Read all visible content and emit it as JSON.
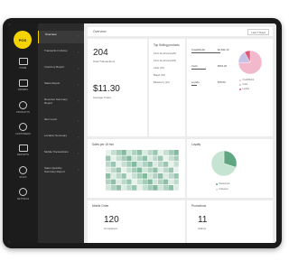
{
  "brand": {
    "logo_text": "POS"
  },
  "rail": [
    {
      "label": "HOME",
      "icon": "grid-icon"
    },
    {
      "label": "ORDERS",
      "icon": "receipt-icon"
    },
    {
      "label": "PRODUCTS",
      "icon": "box-icon"
    },
    {
      "label": "CUSTOMERS",
      "icon": "people-icon"
    },
    {
      "label": "REPORTS",
      "icon": "map-icon"
    },
    {
      "label": "STAFF",
      "icon": "person-icon"
    },
    {
      "label": "SETTINGS",
      "icon": "gear-icon"
    }
  ],
  "menu": [
    {
      "label": "Overview",
      "active": true
    },
    {
      "label": "Transaction History"
    },
    {
      "label": "Inventory Report"
    },
    {
      "label": "Sales Report"
    },
    {
      "label": "Revenue Summary Report"
    },
    {
      "label": "Item Level"
    },
    {
      "label": "Location Summary"
    },
    {
      "label": "Mobile Transactions"
    },
    {
      "label": "Sales Quantity Summary Report"
    }
  ],
  "topbar": {
    "date": "Overview",
    "range": "Last 7 Days"
  },
  "summary": {
    "transactions_value": "204",
    "transactions_label": "Total Transactions",
    "avg_value": "$11.30",
    "avg_label": "Average Ticket"
  },
  "top_products": {
    "title": "Top Selling products",
    "items": [
      "12oz Americano(20)",
      "12oz Americano(18)",
      "Latte (16)",
      "Bagel (15)",
      "Blueberry (12)"
    ]
  },
  "methods": {
    "rows": [
      {
        "label": "Credit/Debit",
        "value": "$1,842.10",
        "bar": 0.8
      },
      {
        "label": "Cash",
        "value": "$361.20",
        "bar": 0.4
      },
      {
        "label": "Loyalty",
        "value": "$78.00",
        "bar": 0.15
      }
    ],
    "legend": [
      "Credit/Debit",
      "Cash",
      "Loyalty"
    ],
    "colors": [
      "#f2b8cb",
      "#c8c2e6",
      "#e05a7a"
    ],
    "shares": [
      0.74,
      0.18,
      0.08
    ]
  },
  "sales": {
    "title": "Sales per 15 min",
    "grid_color": "#5fa683"
  },
  "loyalty": {
    "title": "Loyalty",
    "legend": [
      "Redeemed",
      "Collected"
    ],
    "colors": [
      "#5fa683",
      "#c5e4d2"
    ],
    "shares": [
      0.3,
      0.7
    ]
  },
  "orders": {
    "title": "Mobile Order",
    "value": "120",
    "label": "Completed"
  },
  "promo": {
    "title": "Promotions",
    "value": "11",
    "label": "Claims"
  }
}
